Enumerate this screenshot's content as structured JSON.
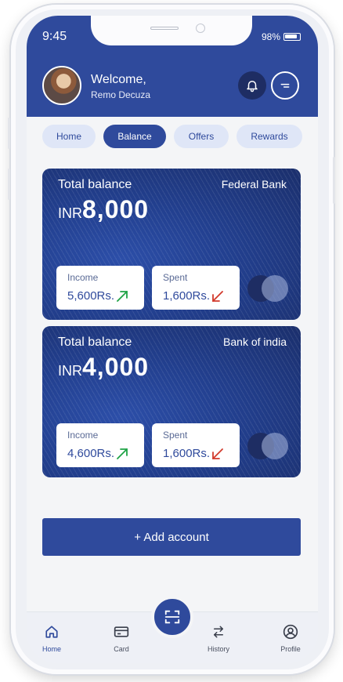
{
  "status_bar": {
    "time": "9:45",
    "battery": "98%"
  },
  "header": {
    "greeting": "Welcome,",
    "username": "Remo Decuza"
  },
  "tabs": [
    {
      "label": "Home",
      "active": false
    },
    {
      "label": "Balance",
      "active": true
    },
    {
      "label": "Offers",
      "active": false
    },
    {
      "label": "Rewards",
      "active": false
    }
  ],
  "cards": [
    {
      "total_label": "Total balance",
      "bank": "Federal Bank",
      "currency": "INR",
      "amount": "8,000",
      "income_label": "Income",
      "income_value": "5,600Rs.",
      "spent_label": "Spent",
      "spent_value": "1,600Rs."
    },
    {
      "total_label": "Total balance",
      "bank": "Bank of india",
      "currency": "INR",
      "amount": "4,000",
      "income_label": "Income",
      "income_value": "4,600Rs.",
      "spent_label": "Spent",
      "spent_value": "1,600Rs."
    }
  ],
  "add_account_label": "+ Add account",
  "nav": [
    {
      "label": "Home",
      "icon": "home-icon"
    },
    {
      "label": "Card",
      "icon": "card-icon"
    },
    {
      "label": "History",
      "icon": "transfer-icon"
    },
    {
      "label": "Profile",
      "icon": "profile-icon"
    }
  ],
  "colors": {
    "primary": "#2f4a9c",
    "income_arrow": "#1fa346",
    "spent_arrow": "#d23a2c"
  }
}
